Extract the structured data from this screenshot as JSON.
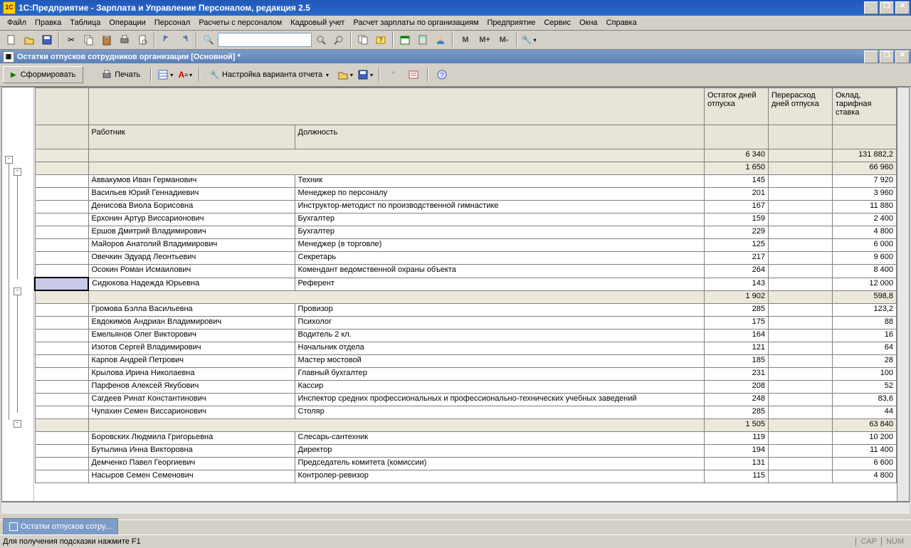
{
  "app_title": "1С:Предприятие - Зарплата и Управление Персоналом, редакция 2.5",
  "menu": [
    "Файл",
    "Правка",
    "Таблица",
    "Операции",
    "Персонал",
    "Расчеты с персоналом",
    "Кадровый учет",
    "Расчет зарплаты по организациям",
    "Предприятие",
    "Сервис",
    "Окна",
    "Справка"
  ],
  "tool_m": [
    "М",
    "М+",
    "М-"
  ],
  "subwin_title": "Остатки отпусков сотрудников организации [Основной] *",
  "action_form": "Сформировать",
  "action_print": "Печать",
  "action_settings": "Настройка варианта отчета",
  "hdr": {
    "worker": "Работник",
    "position": "Должность",
    "days": "Остаток дней отпуска",
    "over": "Перерасход дней отпуска",
    "salary": "Оклад, тарифная ставка"
  },
  "group1": {
    "days": "6 340",
    "salary": "131 882,2"
  },
  "group2": {
    "days": "1 650",
    "salary": "66 960"
  },
  "rows1": [
    {
      "w": "Аввакумов Иван Германович",
      "p": "Техник",
      "d": "145",
      "s": "7 920"
    },
    {
      "w": "Васильев Юрий Геннадиевич",
      "p": "Менеджер по персоналу",
      "d": "201",
      "s": "3 960"
    },
    {
      "w": "Денисова Виола Борисовна",
      "p": "Инструктор-методист по производственной гимнастике",
      "d": "167",
      "s": "11 880"
    },
    {
      "w": "Ерхонин Артур Виссарионович",
      "p": "Бухгалтер",
      "d": "159",
      "s": "2 400"
    },
    {
      "w": "Ершов Дмитрий Владимирович",
      "p": "Бухгалтер",
      "d": "229",
      "s": "4 800"
    },
    {
      "w": "Майоров Анатолий Владимирович",
      "p": "Менеджер (в торговле)",
      "d": "125",
      "s": "6 000"
    },
    {
      "w": "Овечкин Эдуард Леонтьевич",
      "p": "Секретарь",
      "d": "217",
      "s": "9 600"
    },
    {
      "w": "Осокин Роман Исмаилович",
      "p": "Комендант ведомственной охраны объекта",
      "d": "264",
      "s": "8 400"
    },
    {
      "w": "Сидюкова Надежда Юрьевна",
      "p": "Референт",
      "d": "143",
      "s": "12 000"
    }
  ],
  "group3": {
    "days": "1 902",
    "salary": "598,8"
  },
  "rows2": [
    {
      "w": "Громова Бэлла Васильевна",
      "p": "Провизор",
      "d": "285",
      "s": "123,2"
    },
    {
      "w": "Евдокимов Андриан Владимирович",
      "p": "Психолог",
      "d": "175",
      "s": "88"
    },
    {
      "w": "Емельянов Олег Викторович",
      "p": "Водитель 2 кл.",
      "d": "164",
      "s": "16"
    },
    {
      "w": "Изотов Сергей Владимирович",
      "p": "Начальник отдела",
      "d": "121",
      "s": "64"
    },
    {
      "w": "Карпов Андрей Петрович",
      "p": "Мастер мостовой",
      "d": "185",
      "s": "28"
    },
    {
      "w": "Крылова Ирина Николаевна",
      "p": "Главный бухгалтер",
      "d": "231",
      "s": "100"
    },
    {
      "w": "Парфенов Алексей Якубович",
      "p": "Кассир",
      "d": "208",
      "s": "52"
    },
    {
      "w": "Сагдеев Ринат Константинович",
      "p": "Инспектор средних профессиональных и профессионально-технических учебных заведений",
      "d": "248",
      "s": "83,6"
    },
    {
      "w": "Чупахин Семен Виссарионович",
      "p": "Столяр",
      "d": "285",
      "s": "44"
    }
  ],
  "group4": {
    "days": "1 505",
    "salary": "63 840"
  },
  "rows3": [
    {
      "w": "Боровских Людмила Григорьевна",
      "p": "Слесарь-сантехник",
      "d": "119",
      "s": "10 200"
    },
    {
      "w": "Бутылина Инна Викторовна",
      "p": "Директор",
      "d": "194",
      "s": "11 400"
    },
    {
      "w": "Демченко Павел Георгиевич",
      "p": "Председатель комитета (комиссии)",
      "d": "131",
      "s": "6 600"
    },
    {
      "w": "Насыров Семен Семенович",
      "p": "Контролер-ревизор",
      "d": "115",
      "s": "4 800"
    }
  ],
  "tab_label": "Остатки отпусков сотру...",
  "status_text": "Для получения подсказки нажмите F1",
  "status_cap": "CAP",
  "status_num": "NUM"
}
